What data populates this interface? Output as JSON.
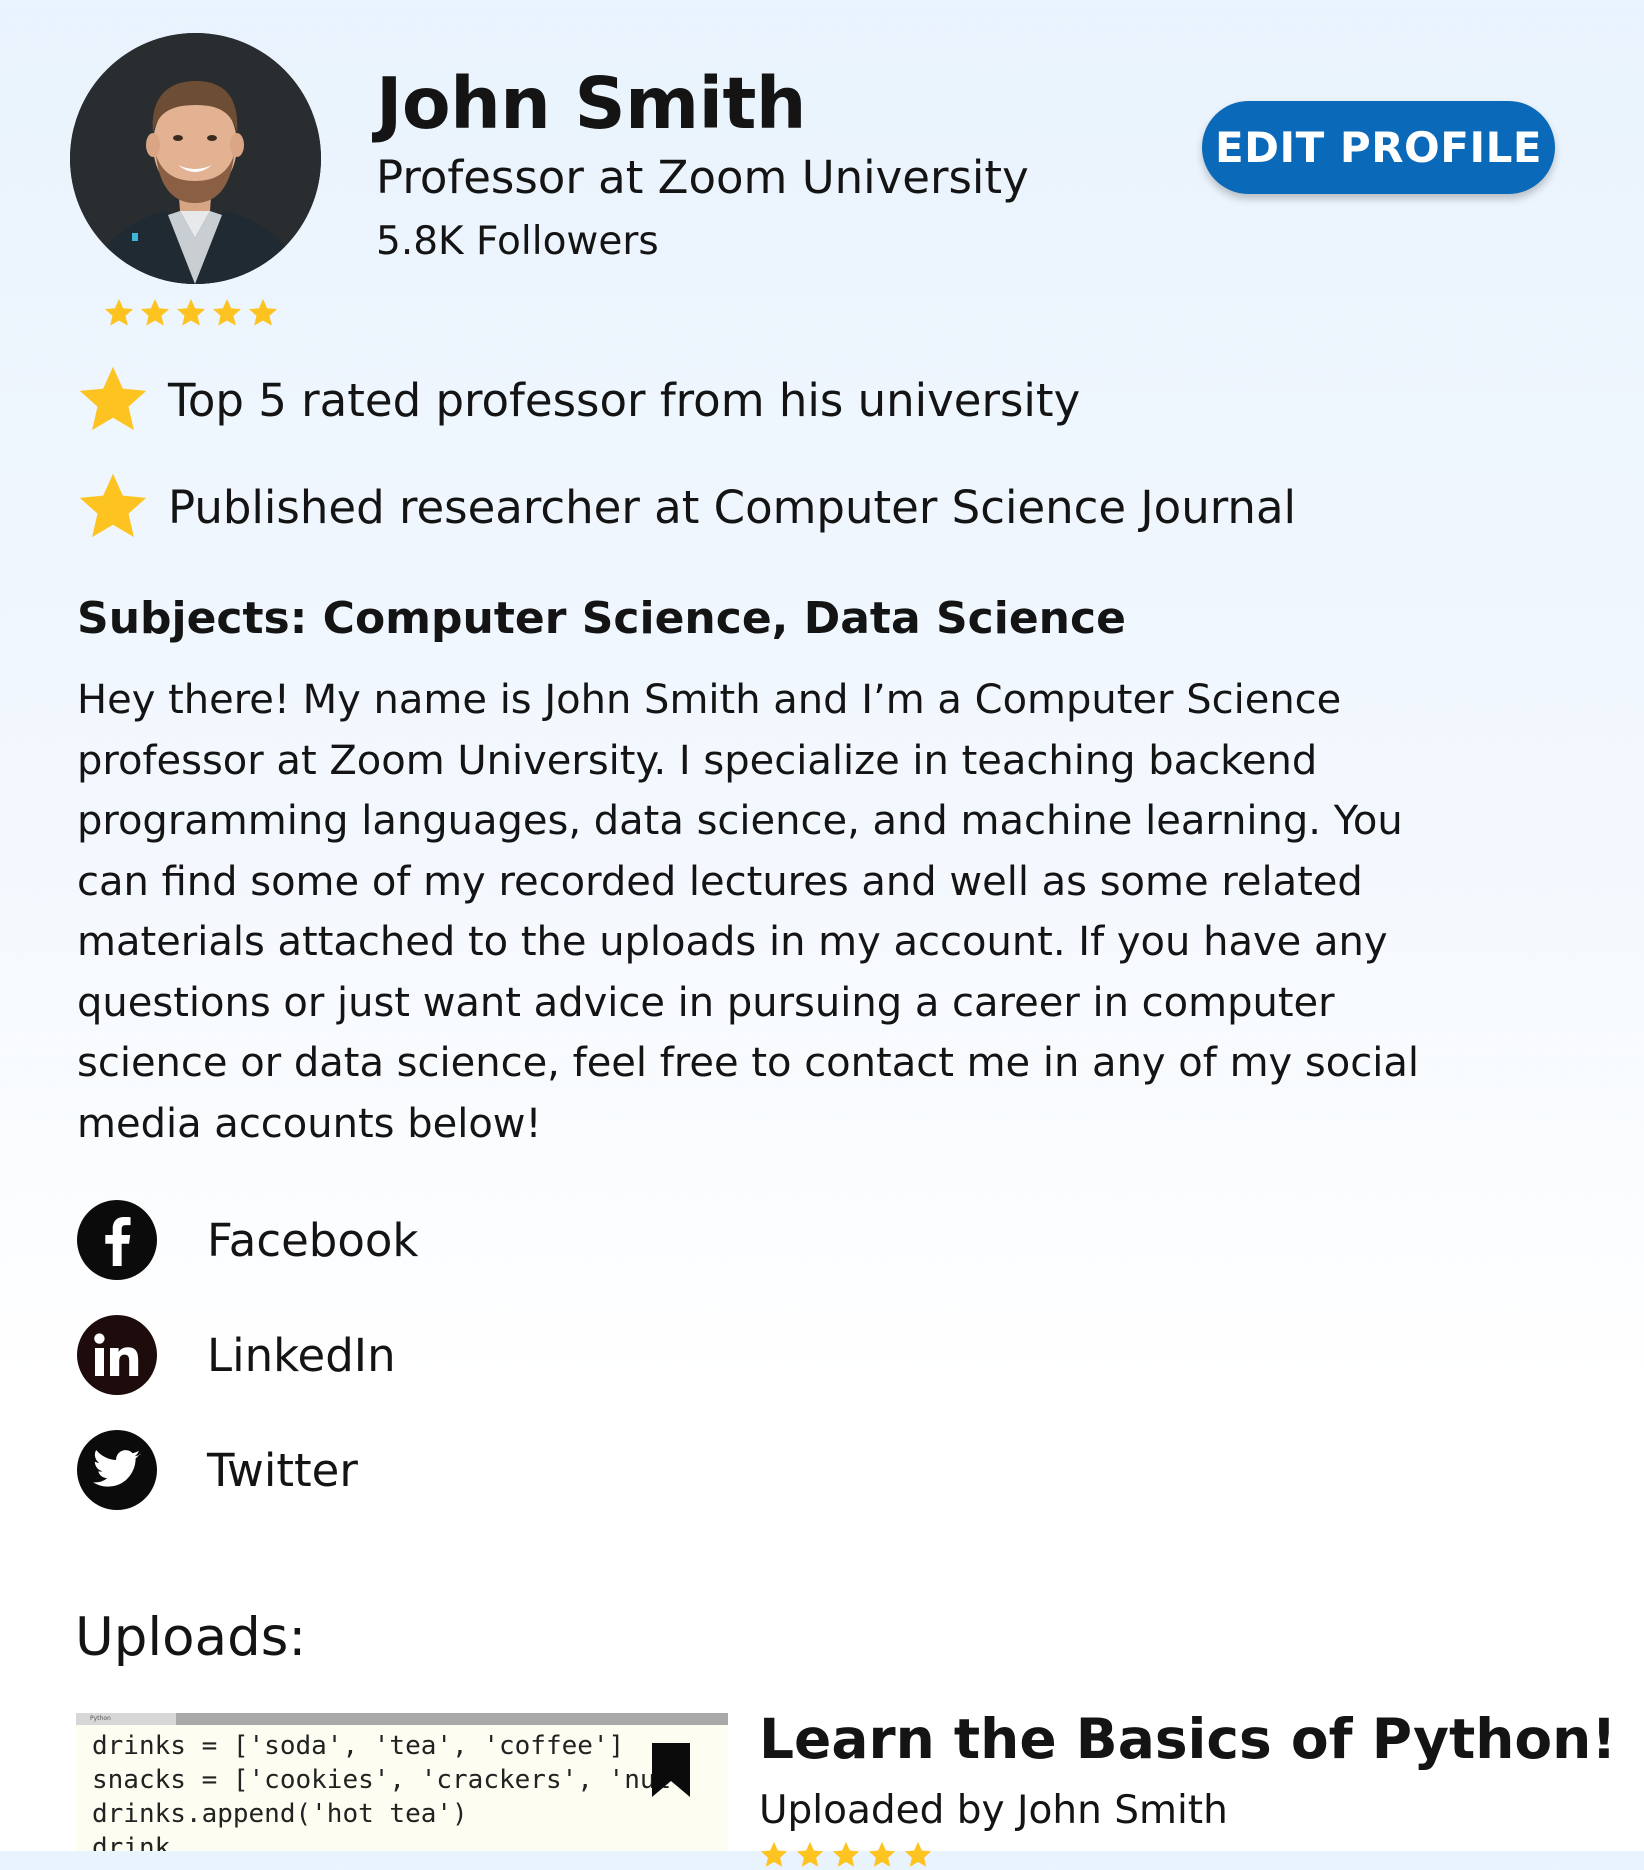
{
  "profile": {
    "name": "John Smith",
    "title": "Professor at Zoom University",
    "followers": "5.8K Followers",
    "rating_stars": 5,
    "edit_label": "EDIT PROFILE"
  },
  "achievements": [
    {
      "icon": "star-icon",
      "text": "Top 5 rated professor from his university"
    },
    {
      "icon": "star-icon",
      "text": "Published researcher at Computer Science Journal"
    }
  ],
  "subjects": "Subjects: Computer Science, Data Science",
  "bio": "Hey there! My name is John Smith and I’m a Computer Science professor at Zoom University. I specialize in teaching backend programming languages, data science, and machine learning. You can find some of my recorded lectures and well as some related materials attached to the uploads in my account. If you have any questions or just want advice in pursuing a career in computer science or data science, feel free to contact me in any of my social media accounts below!",
  "social": [
    {
      "icon": "facebook-icon",
      "label": "Facebook"
    },
    {
      "icon": "linkedin-icon",
      "label": "LinkedIn"
    },
    {
      "icon": "twitter-icon",
      "label": "Twitter"
    }
  ],
  "uploads": {
    "heading": "Uploads:",
    "items": [
      {
        "title": "Learn the Basics of Python!",
        "uploaded_by": "Uploaded by John Smith",
        "thumbnail_tab": "Python",
        "code_lines": [
          "drinks = ['soda', 'tea', 'coffee']",
          "snacks = ['cookies', 'crackers', 'nut",
          "drinks.append('hot tea')",
          "drink"
        ]
      }
    ]
  },
  "colors": {
    "accent": "#0a69b8",
    "star": "#fdc421",
    "text": "#141414"
  }
}
